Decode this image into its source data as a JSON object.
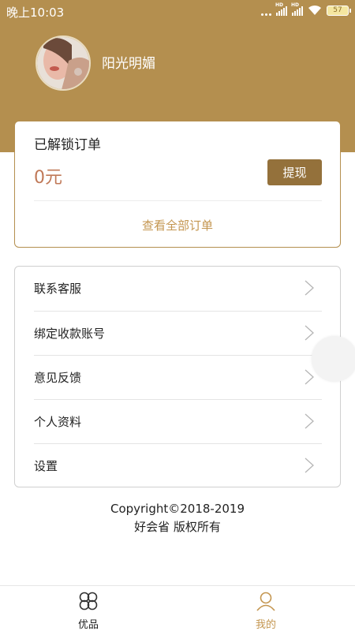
{
  "status_bar": {
    "time": "晚上10:03",
    "battery": "57"
  },
  "profile": {
    "username": "阳光明媚"
  },
  "order_card": {
    "title": "已解锁订单",
    "amount": "0元",
    "withdraw_label": "提现",
    "view_all_label": "查看全部订单"
  },
  "menu": {
    "items": [
      {
        "label": "联系客服"
      },
      {
        "label": "绑定收款账号"
      },
      {
        "label": "意见反馈"
      },
      {
        "label": "个人资料"
      },
      {
        "label": "设置"
      }
    ]
  },
  "footer": {
    "copyright_line1": "Copyright©2018-2019",
    "copyright_line2": "好会省 版权所有"
  },
  "tabbar": {
    "tabs": [
      {
        "label": "优品",
        "icon": "clover-icon",
        "active": false
      },
      {
        "label": "我的",
        "icon": "user-icon",
        "active": true
      }
    ],
    "active_color": "#c49650"
  },
  "colors": {
    "header": "#b48f4f",
    "button": "#94713b",
    "amount": "#c07958",
    "link": "#c49650"
  }
}
